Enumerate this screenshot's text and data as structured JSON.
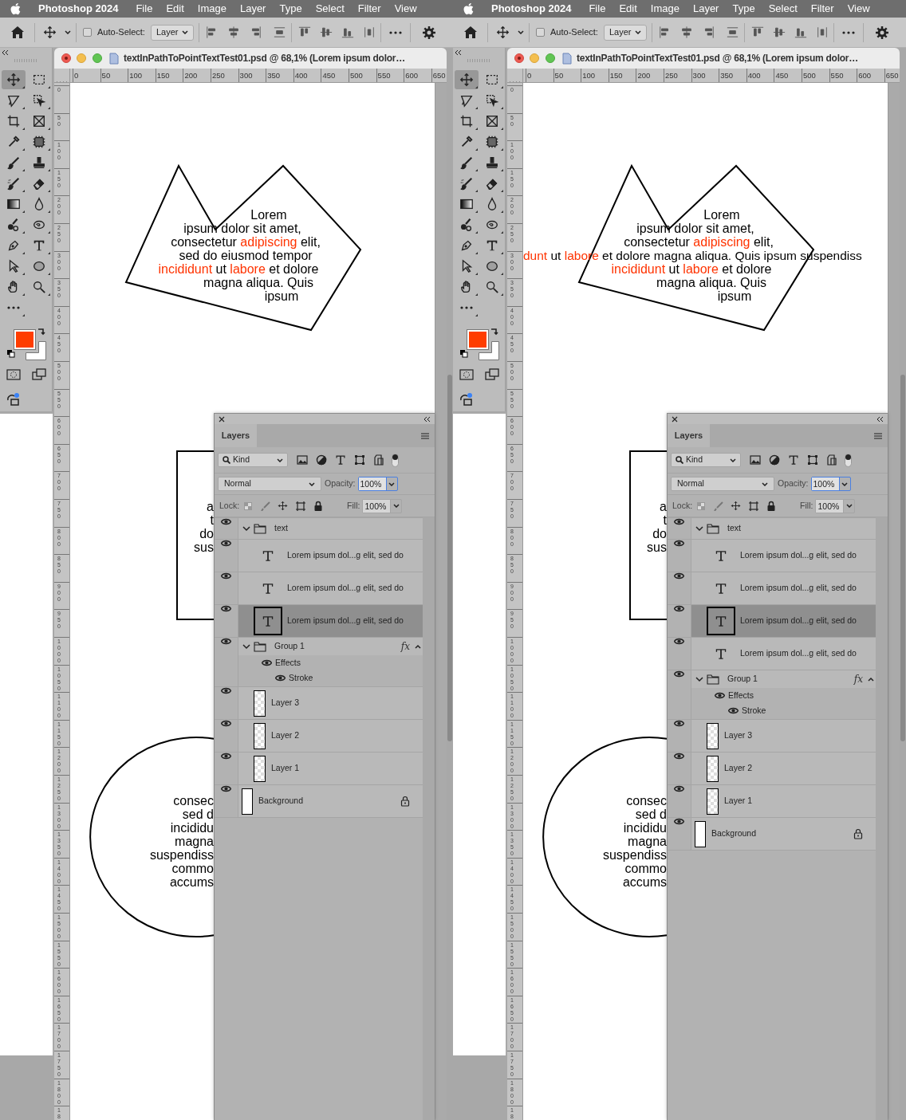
{
  "panes": [
    {
      "menu_bar": {
        "app": "Photoshop 2024",
        "items": [
          "File",
          "Edit",
          "Image",
          "Layer",
          "Type",
          "Select",
          "Filter",
          "View"
        ]
      },
      "options_bar": {
        "auto_select": {
          "label": "Auto-Select:",
          "checked": false
        },
        "target": "Layer"
      },
      "tools": [
        {
          "kind": "move",
          "selected": true
        },
        {
          "kind": "marquee",
          "selected": false
        },
        {
          "kind": "lasso",
          "selected": false
        },
        {
          "kind": "object-select",
          "selected": false
        },
        {
          "kind": "crop",
          "selected": false
        },
        {
          "kind": "frame",
          "selected": false
        },
        {
          "kind": "eyedropper",
          "selected": false
        },
        {
          "kind": "healing",
          "selected": false
        },
        {
          "kind": "brush",
          "selected": false
        },
        {
          "kind": "stamp",
          "selected": false
        },
        {
          "kind": "history-brush",
          "selected": false
        },
        {
          "kind": "eraser",
          "selected": false
        },
        {
          "kind": "gradient",
          "selected": false
        },
        {
          "kind": "blur",
          "selected": false
        },
        {
          "kind": "mixer-brush",
          "selected": false
        },
        {
          "kind": "dodge",
          "selected": false
        },
        {
          "kind": "pen",
          "selected": false
        },
        {
          "kind": "type",
          "selected": false
        },
        {
          "kind": "path-select",
          "selected": false
        },
        {
          "kind": "ellipse",
          "selected": false
        },
        {
          "kind": "hand",
          "selected": false
        },
        {
          "kind": "zoom",
          "selected": false
        },
        {
          "kind": "more",
          "selected": false
        }
      ],
      "swatches": [
        {
          "kind": "foreground",
          "color": "#ff3d00"
        },
        {
          "kind": "background",
          "color": "#ffffff"
        }
      ],
      "document": {
        "title": "textInPathToPointTextTest01.psd @ 68,1% (Lorem ipsum dolor…",
        "h_ruler": [
          "0",
          "50",
          "100",
          "150",
          "200",
          "250",
          "300",
          "350",
          "400",
          "450",
          "500",
          "550",
          "600",
          "650"
        ],
        "v_ruler": [
          "0",
          "50",
          "100",
          "150",
          "200",
          "250",
          "300",
          "350",
          "400",
          "450",
          "500",
          "550",
          "600",
          "650",
          "700",
          "750",
          "800",
          "850",
          "900",
          "950",
          "1000",
          "1050",
          "1100",
          "1150",
          "1200",
          "1250",
          "1300",
          "1350",
          "1400",
          "1450",
          "1500",
          "1550",
          "1600",
          "1650",
          "1700",
          "1750",
          "1800",
          "18"
        ],
        "shapes": [
          {
            "kind": "polygon",
            "lines": [
              {
                "kind": "wrapped",
                "segments": [
                  {
                    "text": "Lorem",
                    "color": "#000000"
                  }
                ]
              },
              {
                "kind": "wrapped",
                "segments": [
                  {
                    "text": "ipsum dolor sit amet,",
                    "color": "#000000"
                  }
                ]
              },
              {
                "kind": "wrapped",
                "segments": [
                  {
                    "text": "consectetur ",
                    "color": "#000000"
                  },
                  {
                    "text": "adipiscing",
                    "color": "#ff3300"
                  },
                  {
                    "text": " elit,",
                    "color": "#000000"
                  }
                ]
              },
              {
                "kind": "wrapped",
                "segments": [
                  {
                    "text": "sed do eiusmod tempor",
                    "color": "#000000"
                  }
                ]
              },
              {
                "kind": "wrapped",
                "segments": [
                  {
                    "text": "incididunt",
                    "color": "#ff3300"
                  },
                  {
                    "text": " ut ",
                    "color": "#000000"
                  },
                  {
                    "text": "labore",
                    "color": "#ff3300"
                  },
                  {
                    "text": " et dolore",
                    "color": "#000000"
                  }
                ]
              },
              {
                "kind": "wrapped",
                "segments": [
                  {
                    "text": "magna aliqua. Quis",
                    "color": "#000000"
                  }
                ]
              },
              {
                "kind": "wrapped",
                "segments": [
                  {
                    "text": "ipsum",
                    "color": "#000000"
                  }
                ]
              }
            ]
          },
          {
            "kind": "rectangle",
            "lines": [
              [
                {
                  "text": "a",
                  "color": "#000000"
                }
              ],
              [
                {
                  "text": "t",
                  "color": "#000000"
                }
              ],
              [
                {
                  "text": "do",
                  "color": "#000000"
                }
              ],
              [
                {
                  "text": "sus",
                  "color": "#000000"
                }
              ]
            ]
          },
          {
            "kind": "ellipse",
            "lines": [
              [
                {
                  "text": "consec",
                  "color": "#000000"
                }
              ],
              [
                {
                  "text": "sed d",
                  "color": "#000000"
                }
              ],
              [
                {
                  "text": "incididu",
                  "color": "#000000"
                }
              ],
              [
                {
                  "text": "magna",
                  "color": "#000000"
                }
              ],
              [
                {
                  "text": "suspendiss",
                  "color": "#000000"
                }
              ],
              [
                {
                  "text": "commo",
                  "color": "#000000"
                }
              ],
              [
                {
                  "text": "accums",
                  "color": "#000000"
                }
              ]
            ]
          }
        ]
      },
      "layers_panel": {
        "tab": "Layers",
        "filter": "Kind",
        "blend_mode": "Normal",
        "opacity_label": "Opacity:",
        "opacity": "100%",
        "lock_label": "Lock:",
        "fill_label": "Fill:",
        "fill": "100%",
        "layers": [
          {
            "kind": "group",
            "name": "text",
            "visible": true,
            "expanded": true,
            "selected": false,
            "children": [
              {
                "kind": "text",
                "name": "Lorem ipsum dol...g elit, sed do",
                "visible": true,
                "selected": false
              },
              {
                "kind": "text",
                "name": "Lorem ipsum dol...g elit, sed do",
                "visible": true,
                "selected": false
              },
              {
                "kind": "text",
                "name": "Lorem ipsum dol...g elit, sed do",
                "visible": true,
                "selected": true
              }
            ]
          },
          {
            "kind": "group",
            "name": "Group 1",
            "visible": true,
            "expanded": true,
            "selected": false,
            "fx": "fx",
            "effects": {
              "label": "Effects",
              "visible": true,
              "items": [
                {
                  "name": "Stroke",
                  "visible": true
                }
              ]
            },
            "children": [
              {
                "kind": "pixel",
                "name": "Layer 3",
                "visible": true,
                "selected": false
              },
              {
                "kind": "pixel",
                "name": "Layer 2",
                "visible": true,
                "selected": false
              },
              {
                "kind": "pixel",
                "name": "Layer 1",
                "visible": true,
                "selected": false
              }
            ]
          },
          {
            "kind": "background",
            "name": "Background",
            "visible": true,
            "selected": false,
            "locked": true
          }
        ]
      }
    },
    {
      "menu_bar": {
        "app": "Photoshop 2024",
        "items": [
          "File",
          "Edit",
          "Image",
          "Layer",
          "Type",
          "Select",
          "Filter",
          "View"
        ]
      },
      "options_bar": {
        "auto_select": {
          "label": "Auto-Select:",
          "checked": false
        },
        "target": "Layer"
      },
      "tools": [
        {
          "kind": "move",
          "selected": true
        },
        {
          "kind": "marquee",
          "selected": false
        },
        {
          "kind": "lasso",
          "selected": false
        },
        {
          "kind": "object-select",
          "selected": false
        },
        {
          "kind": "crop",
          "selected": false
        },
        {
          "kind": "frame",
          "selected": false
        },
        {
          "kind": "eyedropper",
          "selected": false
        },
        {
          "kind": "healing",
          "selected": false
        },
        {
          "kind": "brush",
          "selected": false
        },
        {
          "kind": "stamp",
          "selected": false
        },
        {
          "kind": "history-brush",
          "selected": false
        },
        {
          "kind": "eraser",
          "selected": false
        },
        {
          "kind": "gradient",
          "selected": false
        },
        {
          "kind": "blur",
          "selected": false
        },
        {
          "kind": "mixer-brush",
          "selected": false
        },
        {
          "kind": "dodge",
          "selected": false
        },
        {
          "kind": "pen",
          "selected": false
        },
        {
          "kind": "type",
          "selected": false
        },
        {
          "kind": "path-select",
          "selected": false
        },
        {
          "kind": "ellipse",
          "selected": false
        },
        {
          "kind": "hand",
          "selected": false
        },
        {
          "kind": "zoom",
          "selected": false
        },
        {
          "kind": "more",
          "selected": false
        }
      ],
      "swatches": [
        {
          "kind": "foreground",
          "color": "#ff3d00"
        },
        {
          "kind": "background",
          "color": "#ffffff"
        }
      ],
      "document": {
        "title": "textInPathToPointTextTest01.psd @ 68,1% (Lorem ipsum dolor…",
        "h_ruler": [
          "0",
          "50",
          "100",
          "150",
          "200",
          "250",
          "300",
          "350",
          "400",
          "450",
          "500",
          "550",
          "600",
          "650"
        ],
        "v_ruler": [
          "0",
          "50",
          "100",
          "150",
          "200",
          "250",
          "300",
          "350",
          "400",
          "450",
          "500",
          "550",
          "600",
          "650",
          "700",
          "750",
          "800",
          "850",
          "900",
          "950",
          "1000",
          "1050",
          "1100",
          "1150",
          "1200",
          "1250",
          "1300",
          "1350",
          "1400",
          "1450",
          "1500",
          "1550",
          "1600",
          "1650",
          "1700",
          "1750",
          "1800",
          "18"
        ],
        "shapes": [
          {
            "kind": "polygon",
            "lines": [
              {
                "kind": "wrapped",
                "segments": [
                  {
                    "text": "Lorem",
                    "color": "#000000"
                  }
                ]
              },
              {
                "kind": "wrapped",
                "segments": [
                  {
                    "text": "ipsum dolor sit amet,",
                    "color": "#000000"
                  }
                ]
              },
              {
                "kind": "wrapped",
                "segments": [
                  {
                    "text": "consectetur ",
                    "color": "#000000"
                  },
                  {
                    "text": "adipiscing",
                    "color": "#ff3300"
                  },
                  {
                    "text": " elit,",
                    "color": "#000000"
                  }
                ]
              },
              {
                "kind": "overflow",
                "segments": [
                  {
                    "text": "dunt",
                    "color": "#ff3300"
                  },
                  {
                    "text": " ut ",
                    "color": "#000000"
                  },
                  {
                    "text": "labore",
                    "color": "#ff3300"
                  },
                  {
                    "text": " et dolore magna aliqua. Quis ipsum suspendiss",
                    "color": "#000000"
                  }
                ]
              },
              {
                "kind": "wrapped",
                "segments": [
                  {
                    "text": "incididunt",
                    "color": "#ff3300"
                  },
                  {
                    "text": " ut ",
                    "color": "#000000"
                  },
                  {
                    "text": "labore",
                    "color": "#ff3300"
                  },
                  {
                    "text": " et dolore",
                    "color": "#000000"
                  }
                ]
              },
              {
                "kind": "wrapped",
                "segments": [
                  {
                    "text": "magna aliqua. Quis",
                    "color": "#000000"
                  }
                ]
              },
              {
                "kind": "wrapped",
                "segments": [
                  {
                    "text": "ipsum",
                    "color": "#000000"
                  }
                ]
              }
            ]
          },
          {
            "kind": "rectangle",
            "lines": [
              [
                {
                  "text": "a",
                  "color": "#000000"
                }
              ],
              [
                {
                  "text": "t",
                  "color": "#000000"
                }
              ],
              [
                {
                  "text": "do",
                  "color": "#000000"
                }
              ],
              [
                {
                  "text": "sus",
                  "color": "#000000"
                }
              ]
            ]
          },
          {
            "kind": "ellipse",
            "lines": [
              [
                {
                  "text": "consec",
                  "color": "#000000"
                }
              ],
              [
                {
                  "text": "sed d",
                  "color": "#000000"
                }
              ],
              [
                {
                  "text": "incididu",
                  "color": "#000000"
                }
              ],
              [
                {
                  "text": "magna",
                  "color": "#000000"
                }
              ],
              [
                {
                  "text": "suspendiss",
                  "color": "#000000"
                }
              ],
              [
                {
                  "text": "commo",
                  "color": "#000000"
                }
              ],
              [
                {
                  "text": "accums",
                  "color": "#000000"
                }
              ]
            ]
          }
        ]
      },
      "layers_panel": {
        "tab": "Layers",
        "filter": "Kind",
        "blend_mode": "Normal",
        "opacity_label": "Opacity:",
        "opacity": "100%",
        "lock_label": "Lock:",
        "fill_label": "Fill:",
        "fill": "100%",
        "layers": [
          {
            "kind": "group",
            "name": "text",
            "visible": true,
            "expanded": true,
            "selected": false,
            "children": [
              {
                "kind": "text",
                "name": "Lorem ipsum dol...g elit, sed do",
                "visible": true,
                "selected": false
              },
              {
                "kind": "text",
                "name": "Lorem ipsum dol...g elit, sed do",
                "visible": true,
                "selected": false
              },
              {
                "kind": "text",
                "name": "Lorem ipsum dol...g elit, sed do",
                "visible": true,
                "selected": true
              },
              {
                "kind": "text",
                "name": "Lorem ipsum dol...g elit, sed do",
                "visible": true,
                "selected": false
              }
            ]
          },
          {
            "kind": "group",
            "name": "Group 1",
            "visible": true,
            "expanded": true,
            "selected": false,
            "fx": "fx",
            "effects": {
              "label": "Effects",
              "visible": true,
              "items": [
                {
                  "name": "Stroke",
                  "visible": true
                }
              ]
            },
            "children": [
              {
                "kind": "pixel",
                "name": "Layer 3",
                "visible": true,
                "selected": false
              },
              {
                "kind": "pixel",
                "name": "Layer 2",
                "visible": true,
                "selected": false
              },
              {
                "kind": "pixel",
                "name": "Layer 1",
                "visible": true,
                "selected": false
              }
            ]
          },
          {
            "kind": "background",
            "name": "Background",
            "visible": true,
            "selected": false,
            "locked": true
          }
        ]
      }
    }
  ]
}
